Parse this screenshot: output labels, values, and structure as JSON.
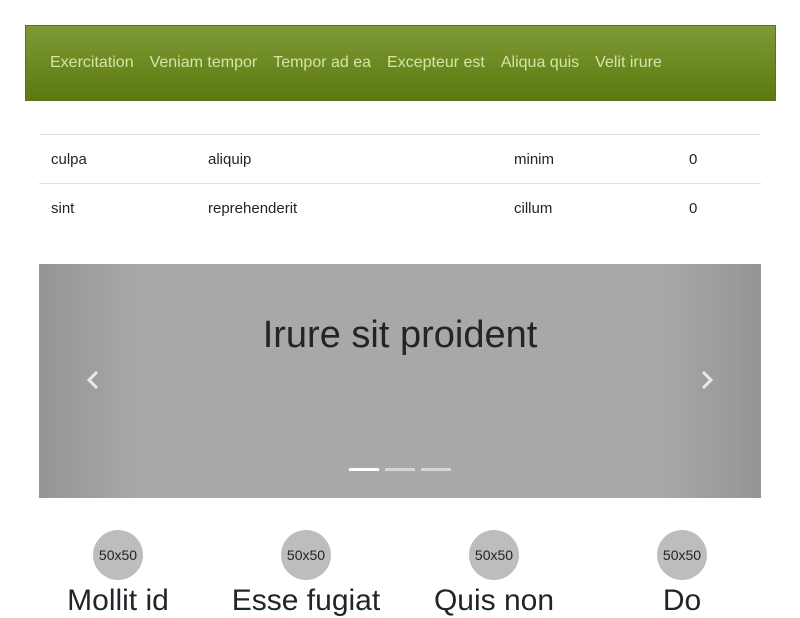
{
  "navbar": {
    "links": [
      "Exercitation",
      "Veniam tempor",
      "Tempor ad ea",
      "Excepteur est",
      "Aliqua quis",
      "Velit irure"
    ]
  },
  "table": {
    "rows": [
      [
        "culpa",
        "aliquip",
        "minim",
        "0"
      ],
      [
        "sint",
        "reprehenderit",
        "cillum",
        "0"
      ]
    ]
  },
  "carousel": {
    "caption": "Irure sit proident",
    "prev_icon": "chevron-left-icon",
    "next_icon": "chevron-right-icon",
    "active_slide": 1,
    "slide_count": 3
  },
  "features": [
    {
      "thumb": "50x50",
      "title": "Mollit id"
    },
    {
      "thumb": "50x50",
      "title": "Esse fugiat"
    },
    {
      "thumb": "50x50",
      "title": "Quis non"
    },
    {
      "thumb": "50x50",
      "title": "Do"
    }
  ],
  "colors": {
    "navbar": "#6b8a1f",
    "nav_link": "#d6e4a8",
    "carousel_bg": "#a8a8a8",
    "thumb_bg": "#bdbdbd"
  }
}
